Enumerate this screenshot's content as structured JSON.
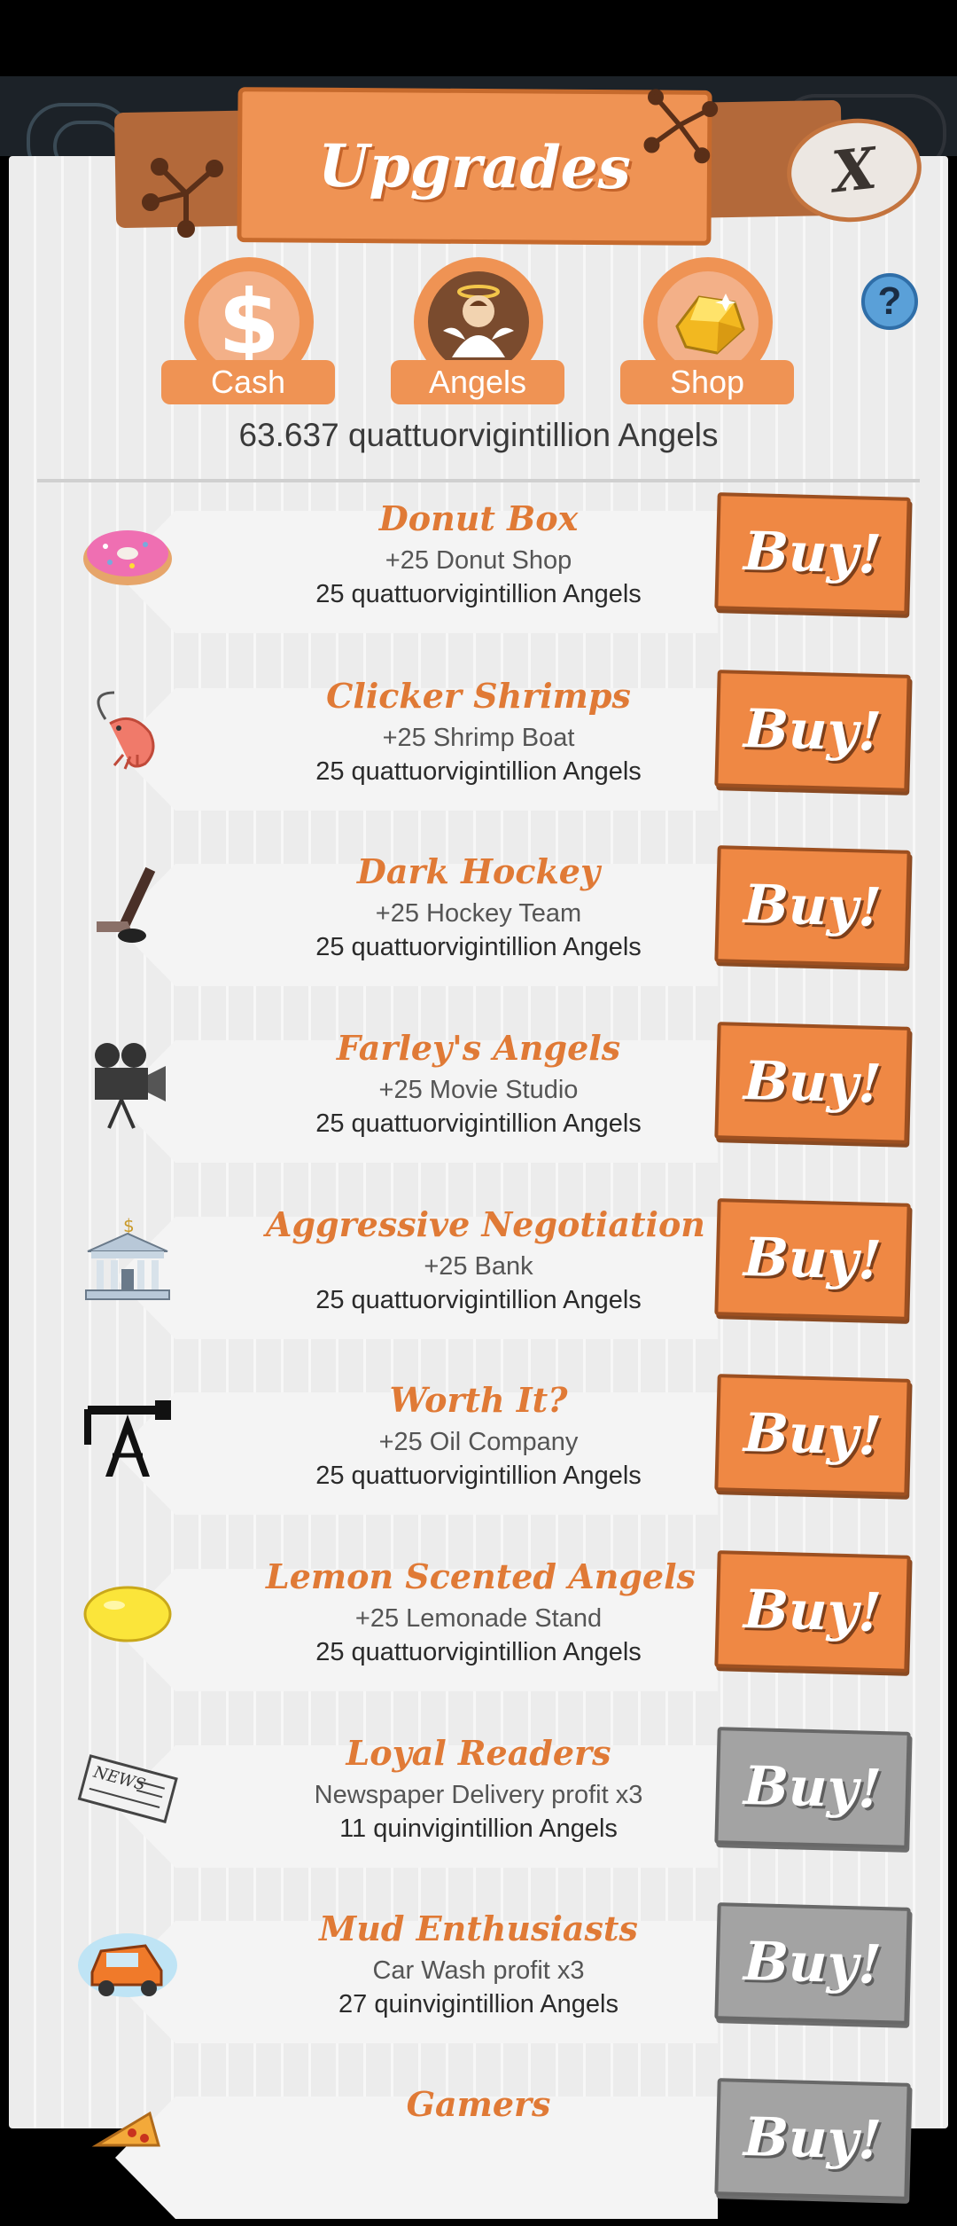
{
  "header": {
    "title": "Upgrades",
    "close_label": "X",
    "help_label": "?"
  },
  "tabs": [
    {
      "label": "Cash",
      "icon": "dollar-icon"
    },
    {
      "label": "Angels",
      "icon": "angel-icon"
    },
    {
      "label": "Shop",
      "icon": "gold-gem-icon"
    }
  ],
  "angels_total": "63.637 quattuorvigintillion Angels",
  "upgrades": [
    {
      "name": "Donut Box",
      "effect": "+25 Donut Shop",
      "cost": "25 quattuorvigintillion Angels",
      "buy_label": "Buy!",
      "enabled": true,
      "icon": "donut-icon"
    },
    {
      "name": "Clicker Shrimps",
      "effect": "+25 Shrimp Boat",
      "cost": "25 quattuorvigintillion Angels",
      "buy_label": "Buy!",
      "enabled": true,
      "icon": "shrimp-icon"
    },
    {
      "name": "Dark Hockey",
      "effect": "+25 Hockey Team",
      "cost": "25 quattuorvigintillion Angels",
      "buy_label": "Buy!",
      "enabled": true,
      "icon": "hockey-stick-icon"
    },
    {
      "name": "Farley's Angels",
      "effect": "+25 Movie Studio",
      "cost": "25 quattuorvigintillion Angels",
      "buy_label": "Buy!",
      "enabled": true,
      "icon": "movie-camera-icon"
    },
    {
      "name": "Aggressive Negotiation",
      "effect": "+25 Bank",
      "cost": "25 quattuorvigintillion Angels",
      "buy_label": "Buy!",
      "enabled": true,
      "icon": "bank-icon"
    },
    {
      "name": "Worth It?",
      "effect": "+25 Oil Company",
      "cost": "25 quattuorvigintillion Angels",
      "buy_label": "Buy!",
      "enabled": true,
      "icon": "oil-pump-icon"
    },
    {
      "name": "Lemon Scented Angels",
      "effect": "+25 Lemonade Stand",
      "cost": "25 quattuorvigintillion Angels",
      "buy_label": "Buy!",
      "enabled": true,
      "icon": "lemon-icon"
    },
    {
      "name": "Loyal Readers",
      "effect": "Newspaper Delivery profit x3",
      "cost": "11 quinvigintillion Angels",
      "buy_label": "Buy!",
      "enabled": false,
      "icon": "newspaper-icon"
    },
    {
      "name": "Mud Enthusiasts",
      "effect": "Car Wash profit x3",
      "cost": "27 quinvigintillion Angels",
      "buy_label": "Buy!",
      "enabled": false,
      "icon": "car-icon"
    },
    {
      "name": "Gamers",
      "effect": "",
      "cost": "",
      "buy_label": "Buy!",
      "enabled": false,
      "icon": "pizza-icon"
    }
  ],
  "colors": {
    "accent": "#ef9354",
    "buy_enabled": "#ef8844",
    "buy_disabled": "#a3a3a3",
    "upgrade_name": "#e07a36"
  }
}
